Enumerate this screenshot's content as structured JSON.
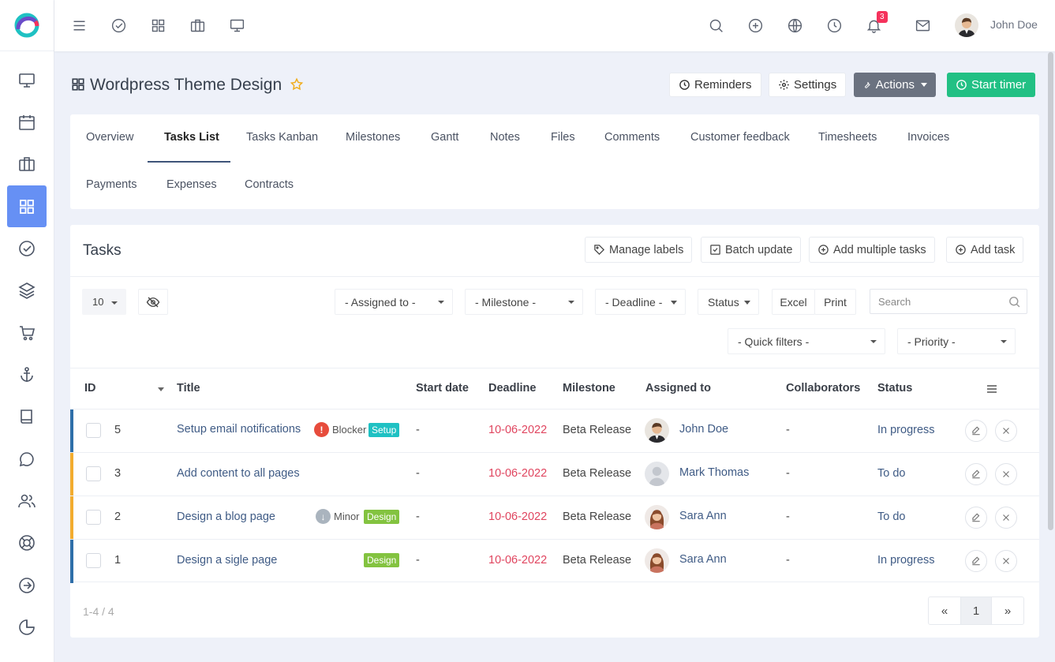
{
  "user": {
    "name": "John Doe"
  },
  "notifications": {
    "count": "3"
  },
  "project": {
    "title": "Wordpress Theme Design"
  },
  "header_buttons": {
    "reminders": "Reminders",
    "settings": "Settings",
    "actions": "Actions",
    "start_timer": "Start timer"
  },
  "tabs": [
    "Overview",
    "Tasks List",
    "Tasks Kanban",
    "Milestones",
    "Gantt",
    "Notes",
    "Files",
    "Comments",
    "Customer feedback",
    "Timesheets",
    "Invoices",
    "Payments",
    "Expenses",
    "Contracts"
  ],
  "tasks": {
    "title": "Tasks",
    "buttons": {
      "manage_labels": "Manage labels",
      "batch_update": "Batch update",
      "add_multiple": "Add multiple tasks",
      "add_task": "Add task"
    },
    "filters": {
      "page_size": "10",
      "assigned_to": "- Assigned to -",
      "milestone": "- Milestone -",
      "deadline": "- Deadline -",
      "status": "Status",
      "excel": "Excel",
      "print": "Print",
      "search_placeholder": "Search",
      "quick_filters": "- Quick filters -",
      "priority": "- Priority -"
    },
    "columns": {
      "id": "ID",
      "title": "Title",
      "start_date": "Start date",
      "deadline": "Deadline",
      "milestone": "Milestone",
      "assigned_to": "Assigned to",
      "collaborators": "Collaborators",
      "status": "Status"
    },
    "rows": [
      {
        "id": "5",
        "title": "Setup email notifications",
        "priority": "Blocker",
        "label": "Setup",
        "start": "-",
        "deadline": "10-06-2022",
        "milestone": "Beta Release",
        "assignee": "John Doe",
        "collaborators": "-",
        "status": "In progress"
      },
      {
        "id": "3",
        "title": "Add content to all pages",
        "priority": "",
        "label": "",
        "start": "-",
        "deadline": "10-06-2022",
        "milestone": "Beta Release",
        "assignee": "Mark Thomas",
        "collaborators": "-",
        "status": "To do"
      },
      {
        "id": "2",
        "title": "Design a blog page",
        "priority": "Minor",
        "label": "Design",
        "start": "-",
        "deadline": "10-06-2022",
        "milestone": "Beta Release",
        "assignee": "Sara Ann",
        "collaborators": "-",
        "status": "To do"
      },
      {
        "id": "1",
        "title": "Design a sigle page",
        "priority": "",
        "label": "Design",
        "start": "-",
        "deadline": "10-06-2022",
        "milestone": "Beta Release",
        "assignee": "Sara Ann",
        "collaborators": "-",
        "status": "In progress"
      }
    ],
    "footer": {
      "range": "1-4 / 4",
      "current_page": "1",
      "prev": "«",
      "next": "»"
    }
  },
  "colors": {
    "accent": "#6690f4",
    "green": "#22c084",
    "blocker": "#e74c3c",
    "minor": "#aab4be",
    "label_setup": "#1fc1c3",
    "label_design": "#83c340",
    "bar_blue": "#2f6fa9",
    "bar_yellow": "#f2ac2f"
  }
}
